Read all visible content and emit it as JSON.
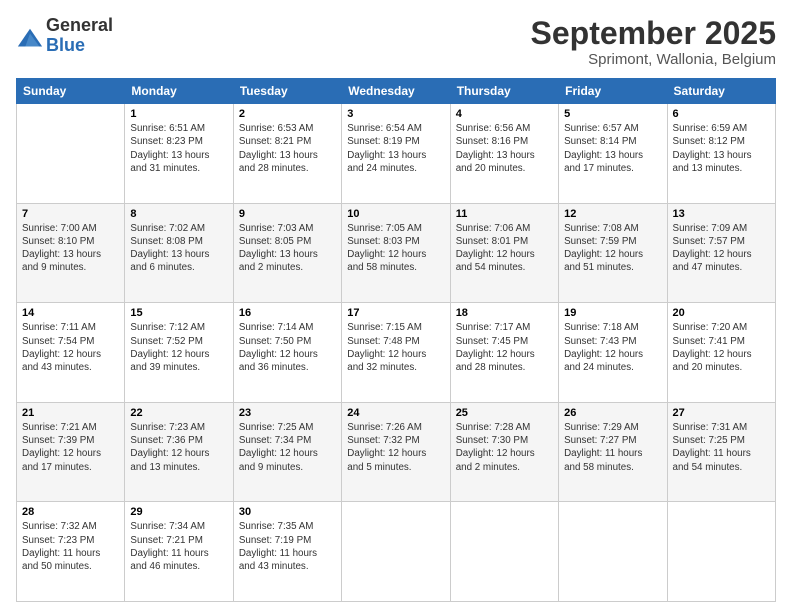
{
  "logo": {
    "general": "General",
    "blue": "Blue"
  },
  "title": "September 2025",
  "subtitle": "Sprimont, Wallonia, Belgium",
  "days_of_week": [
    "Sunday",
    "Monday",
    "Tuesday",
    "Wednesday",
    "Thursday",
    "Friday",
    "Saturday"
  ],
  "weeks": [
    [
      {
        "day": "",
        "info": ""
      },
      {
        "day": "1",
        "info": "Sunrise: 6:51 AM\nSunset: 8:23 PM\nDaylight: 13 hours\nand 31 minutes."
      },
      {
        "day": "2",
        "info": "Sunrise: 6:53 AM\nSunset: 8:21 PM\nDaylight: 13 hours\nand 28 minutes."
      },
      {
        "day": "3",
        "info": "Sunrise: 6:54 AM\nSunset: 8:19 PM\nDaylight: 13 hours\nand 24 minutes."
      },
      {
        "day": "4",
        "info": "Sunrise: 6:56 AM\nSunset: 8:16 PM\nDaylight: 13 hours\nand 20 minutes."
      },
      {
        "day": "5",
        "info": "Sunrise: 6:57 AM\nSunset: 8:14 PM\nDaylight: 13 hours\nand 17 minutes."
      },
      {
        "day": "6",
        "info": "Sunrise: 6:59 AM\nSunset: 8:12 PM\nDaylight: 13 hours\nand 13 minutes."
      }
    ],
    [
      {
        "day": "7",
        "info": "Sunrise: 7:00 AM\nSunset: 8:10 PM\nDaylight: 13 hours\nand 9 minutes."
      },
      {
        "day": "8",
        "info": "Sunrise: 7:02 AM\nSunset: 8:08 PM\nDaylight: 13 hours\nand 6 minutes."
      },
      {
        "day": "9",
        "info": "Sunrise: 7:03 AM\nSunset: 8:05 PM\nDaylight: 13 hours\nand 2 minutes."
      },
      {
        "day": "10",
        "info": "Sunrise: 7:05 AM\nSunset: 8:03 PM\nDaylight: 12 hours\nand 58 minutes."
      },
      {
        "day": "11",
        "info": "Sunrise: 7:06 AM\nSunset: 8:01 PM\nDaylight: 12 hours\nand 54 minutes."
      },
      {
        "day": "12",
        "info": "Sunrise: 7:08 AM\nSunset: 7:59 PM\nDaylight: 12 hours\nand 51 minutes."
      },
      {
        "day": "13",
        "info": "Sunrise: 7:09 AM\nSunset: 7:57 PM\nDaylight: 12 hours\nand 47 minutes."
      }
    ],
    [
      {
        "day": "14",
        "info": "Sunrise: 7:11 AM\nSunset: 7:54 PM\nDaylight: 12 hours\nand 43 minutes."
      },
      {
        "day": "15",
        "info": "Sunrise: 7:12 AM\nSunset: 7:52 PM\nDaylight: 12 hours\nand 39 minutes."
      },
      {
        "day": "16",
        "info": "Sunrise: 7:14 AM\nSunset: 7:50 PM\nDaylight: 12 hours\nand 36 minutes."
      },
      {
        "day": "17",
        "info": "Sunrise: 7:15 AM\nSunset: 7:48 PM\nDaylight: 12 hours\nand 32 minutes."
      },
      {
        "day": "18",
        "info": "Sunrise: 7:17 AM\nSunset: 7:45 PM\nDaylight: 12 hours\nand 28 minutes."
      },
      {
        "day": "19",
        "info": "Sunrise: 7:18 AM\nSunset: 7:43 PM\nDaylight: 12 hours\nand 24 minutes."
      },
      {
        "day": "20",
        "info": "Sunrise: 7:20 AM\nSunset: 7:41 PM\nDaylight: 12 hours\nand 20 minutes."
      }
    ],
    [
      {
        "day": "21",
        "info": "Sunrise: 7:21 AM\nSunset: 7:39 PM\nDaylight: 12 hours\nand 17 minutes."
      },
      {
        "day": "22",
        "info": "Sunrise: 7:23 AM\nSunset: 7:36 PM\nDaylight: 12 hours\nand 13 minutes."
      },
      {
        "day": "23",
        "info": "Sunrise: 7:25 AM\nSunset: 7:34 PM\nDaylight: 12 hours\nand 9 minutes."
      },
      {
        "day": "24",
        "info": "Sunrise: 7:26 AM\nSunset: 7:32 PM\nDaylight: 12 hours\nand 5 minutes."
      },
      {
        "day": "25",
        "info": "Sunrise: 7:28 AM\nSunset: 7:30 PM\nDaylight: 12 hours\nand 2 minutes."
      },
      {
        "day": "26",
        "info": "Sunrise: 7:29 AM\nSunset: 7:27 PM\nDaylight: 11 hours\nand 58 minutes."
      },
      {
        "day": "27",
        "info": "Sunrise: 7:31 AM\nSunset: 7:25 PM\nDaylight: 11 hours\nand 54 minutes."
      }
    ],
    [
      {
        "day": "28",
        "info": "Sunrise: 7:32 AM\nSunset: 7:23 PM\nDaylight: 11 hours\nand 50 minutes."
      },
      {
        "day": "29",
        "info": "Sunrise: 7:34 AM\nSunset: 7:21 PM\nDaylight: 11 hours\nand 46 minutes."
      },
      {
        "day": "30",
        "info": "Sunrise: 7:35 AM\nSunset: 7:19 PM\nDaylight: 11 hours\nand 43 minutes."
      },
      {
        "day": "",
        "info": ""
      },
      {
        "day": "",
        "info": ""
      },
      {
        "day": "",
        "info": ""
      },
      {
        "day": "",
        "info": ""
      }
    ]
  ]
}
